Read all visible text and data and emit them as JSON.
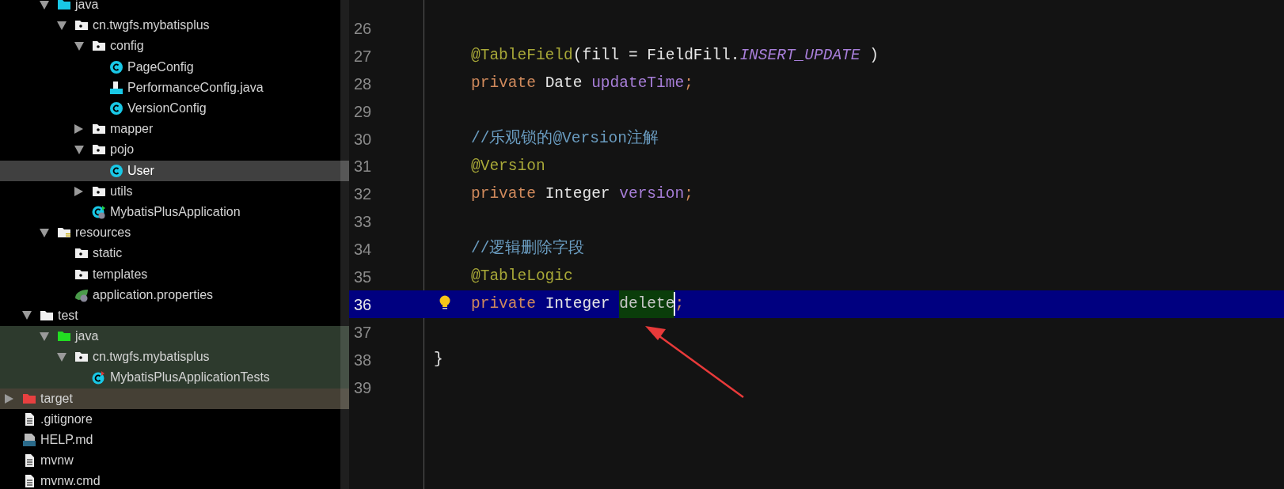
{
  "project_tree": [
    {
      "children": [
        {
          "children": [
            {
              "label": "java",
              "kind": "source-folder",
              "expanded": true,
              "selected": false,
              "children": [
                {
                  "label": "cn.twgfs.mybatisplus",
                  "kind": "package",
                  "expanded": true,
                  "selected": false,
                  "children": [
                    {
                      "label": "config",
                      "kind": "package",
                      "expanded": true,
                      "selected": false,
                      "children": [
                        {
                          "label": "PageConfig",
                          "kind": "class",
                          "selected": false
                        },
                        {
                          "label": "PerformanceConfig.java",
                          "kind": "java-file",
                          "selected": false
                        },
                        {
                          "label": "VersionConfig",
                          "kind": "class",
                          "selected": false
                        }
                      ]
                    },
                    {
                      "label": "mapper",
                      "kind": "package",
                      "expanded": false,
                      "selected": false
                    },
                    {
                      "label": "pojo",
                      "kind": "package",
                      "expanded": true,
                      "selected": false,
                      "children": [
                        {
                          "label": "User",
                          "kind": "class",
                          "selected": true
                        }
                      ]
                    },
                    {
                      "label": "utils",
                      "kind": "package",
                      "expanded": false,
                      "selected": false
                    },
                    {
                      "label": "MybatisPlusApplication",
                      "kind": "spring-class",
                      "selected": false
                    }
                  ]
                }
              ]
            },
            {
              "label": "resources",
              "kind": "resources-folder",
              "expanded": true,
              "selected": false,
              "children": [
                {
                  "label": "static",
                  "kind": "package",
                  "selected": false
                },
                {
                  "label": "templates",
                  "kind": "package",
                  "selected": false
                },
                {
                  "label": "application.properties",
                  "kind": "properties",
                  "selected": false
                }
              ]
            }
          ]
        },
        {
          "label": "test",
          "kind": "folder",
          "expanded": true,
          "selected": false,
          "children": [
            {
              "label": "java",
              "kind": "test-folder",
              "expanded": true,
              "selected": false,
              "color": "#2d3a2d",
              "children": [
                {
                  "label": "cn.twgfs.mybatisplus",
                  "kind": "package",
                  "expanded": true,
                  "selected": false,
                  "color": "#2d3a2d",
                  "children": [
                    {
                      "label": "MybatisPlusApplicationTests",
                      "kind": "test-class",
                      "selected": false,
                      "color": "#2d3a2d"
                    }
                  ]
                }
              ]
            }
          ]
        }
      ]
    },
    {
      "label": "target",
      "kind": "excluded-folder",
      "expanded": false,
      "selected": false,
      "color": "#454035"
    },
    {
      "label": ".gitignore",
      "kind": "file",
      "selected": false
    },
    {
      "label": "HELP.md",
      "kind": "markdown",
      "selected": false
    },
    {
      "label": "mvnw",
      "kind": "file",
      "selected": false
    },
    {
      "label": "mvnw.cmd",
      "kind": "file",
      "selected": false
    }
  ],
  "editor": {
    "lines": [
      {
        "number": "26",
        "kind": "blank"
      },
      {
        "number": "27",
        "kind": "body",
        "tokens": [
          {
            "kind": "annotation",
            "text": "@TableField"
          },
          {
            "kind": "plain",
            "text": "(fill = FieldFill."
          },
          {
            "kind": "constant",
            "text": "INSERT_UPDATE"
          },
          {
            "kind": "plain",
            "text": " )"
          }
        ]
      },
      {
        "number": "28",
        "kind": "body",
        "tokens": [
          {
            "kind": "keyword",
            "text": "private "
          },
          {
            "kind": "type",
            "text": "Date "
          },
          {
            "kind": "field",
            "text": "updateTime"
          },
          {
            "kind": "punct",
            "text": ";"
          }
        ]
      },
      {
        "number": "29",
        "kind": "blank"
      },
      {
        "number": "30",
        "kind": "body",
        "tokens": [
          {
            "kind": "comment",
            "text": "//乐观锁的@Version注解"
          }
        ]
      },
      {
        "number": "31",
        "kind": "body",
        "tokens": [
          {
            "kind": "annotation",
            "text": "@Version"
          }
        ]
      },
      {
        "number": "32",
        "kind": "body",
        "tokens": [
          {
            "kind": "keyword",
            "text": "private "
          },
          {
            "kind": "type",
            "text": "Integer "
          },
          {
            "kind": "field",
            "text": "version"
          },
          {
            "kind": "punct",
            "text": ";"
          }
        ]
      },
      {
        "number": "33",
        "kind": "blank"
      },
      {
        "number": "34",
        "kind": "body",
        "tokens": [
          {
            "kind": "comment",
            "text": "//逻辑删除字段"
          }
        ]
      },
      {
        "number": "35",
        "kind": "body",
        "tokens": [
          {
            "kind": "annotation",
            "text": "@TableLogic"
          }
        ]
      },
      {
        "number": "36",
        "kind": "body",
        "current": true,
        "hint": true,
        "tokens": [
          {
            "kind": "keyword",
            "text": "private "
          },
          {
            "kind": "type",
            "text": "Integer "
          },
          {
            "kind": "field",
            "text": "delete",
            "highlighted": true,
            "caret": true
          },
          {
            "kind": "punct",
            "text": ";"
          }
        ]
      },
      {
        "number": "37",
        "kind": "blank"
      },
      {
        "number": "38",
        "kind": "top",
        "tokens": [
          {
            "kind": "plain",
            "text": "}"
          }
        ]
      },
      {
        "number": "39",
        "kind": "blank"
      }
    ]
  }
}
